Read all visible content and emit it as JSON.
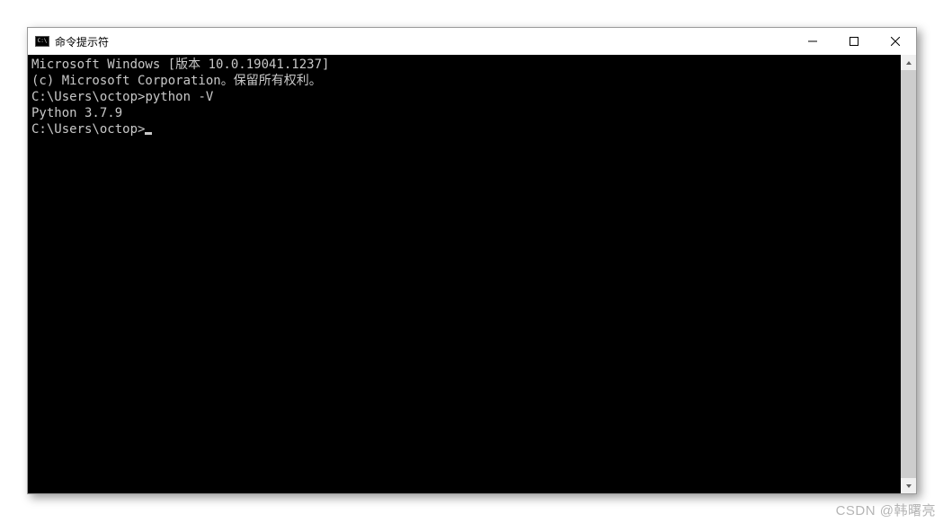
{
  "window": {
    "title": "命令提示符"
  },
  "terminal": {
    "lines": {
      "l0": "Microsoft Windows [版本 10.0.19041.1237]",
      "l1": "(c) Microsoft Corporation。保留所有权利。",
      "l2": "",
      "l3_prompt": "C:\\Users\\octop>",
      "l3_cmd": "python -V",
      "l4": "Python 3.7.9",
      "l5": "",
      "l6_prompt": "C:\\Users\\octop>"
    }
  },
  "watermark": "CSDN @韩曙亮"
}
